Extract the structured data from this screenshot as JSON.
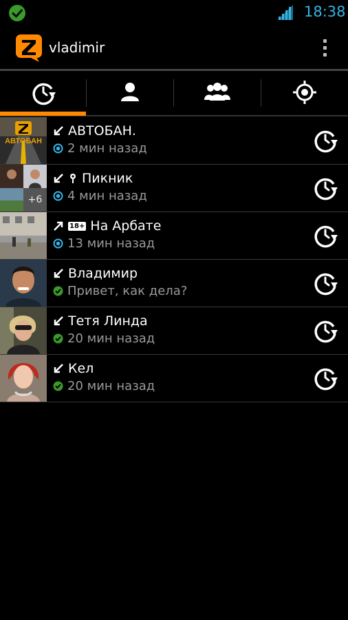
{
  "status_bar": {
    "time": "18:38",
    "accent": "#33b5e5"
  },
  "app": {
    "title": "vladimir",
    "brand_color": "#ff8a00"
  },
  "tabs": [
    {
      "name": "tab-recent",
      "icon": "recent-clock-icon",
      "selected": true
    },
    {
      "name": "tab-contacts",
      "icon": "person-icon",
      "selected": false
    },
    {
      "name": "tab-groups",
      "icon": "group-icon",
      "selected": false
    },
    {
      "name": "tab-location",
      "icon": "location-target-icon",
      "selected": false
    }
  ],
  "chats": [
    {
      "title": "АВТОБАН.",
      "subtitle": "2 мин назад",
      "direction": "incoming",
      "status": "seen-blue"
    },
    {
      "title": "Пикник",
      "subtitle": "4 мин назад",
      "direction": "incoming",
      "status": "seen-blue",
      "extra": "pin",
      "more_count": "+6"
    },
    {
      "title": "На Арбате",
      "subtitle": "13 мин назад",
      "direction": "outgoing",
      "status": "seen-blue",
      "badge": "18+"
    },
    {
      "title": "Владимир",
      "subtitle": "Привет, как дела?",
      "direction": "incoming",
      "status": "read-green"
    },
    {
      "title": "Тетя Линда",
      "subtitle": "20 мин назад",
      "direction": "incoming",
      "status": "read-green"
    },
    {
      "title": "Кел",
      "subtitle": "20 мин назад",
      "direction": "incoming",
      "status": "read-green"
    }
  ],
  "thumb_texts": {
    "autobahn": "АВТОБАН"
  }
}
